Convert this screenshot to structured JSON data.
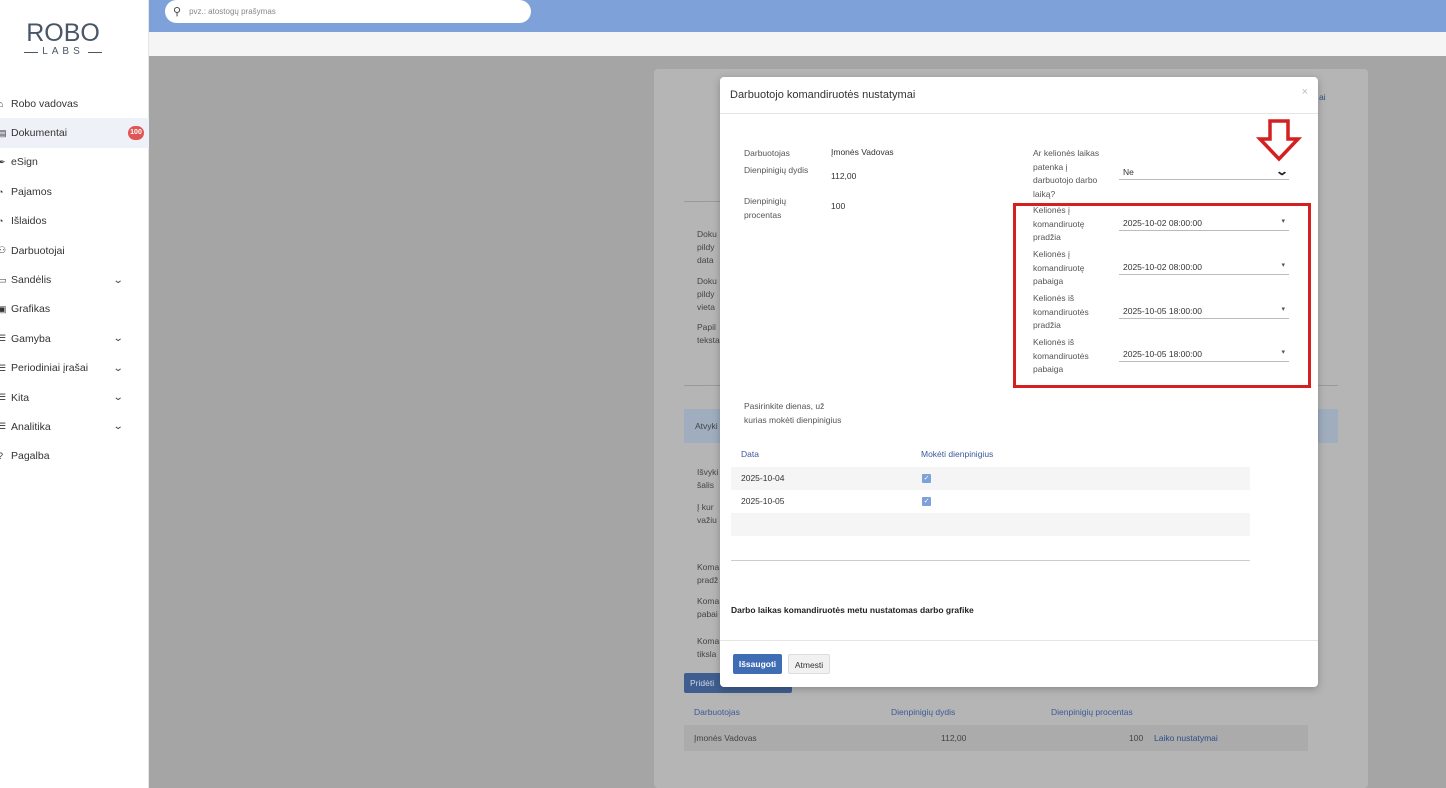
{
  "logo": {
    "main": "ROBO",
    "sub": "LABS"
  },
  "search": {
    "placeholder": "pvz.: atostogų prašymas"
  },
  "sidebar": {
    "items": [
      {
        "label": "Robo vadovas",
        "icon": "home-icon"
      },
      {
        "label": "Dokumentai",
        "icon": "document-icon",
        "badge": "100"
      },
      {
        "label": "eSign",
        "icon": "pen-icon"
      },
      {
        "label": "Pajamos",
        "icon": "income-icon"
      },
      {
        "label": "Išlaidos",
        "icon": "expense-icon"
      },
      {
        "label": "Darbuotojai",
        "icon": "people-icon"
      },
      {
        "label": "Sandėlis",
        "icon": "warehouse-icon"
      },
      {
        "label": "Grafikas",
        "icon": "calendar-icon"
      },
      {
        "label": "Gamyba",
        "icon": "list-icon"
      },
      {
        "label": "Periodiniai įrašai",
        "icon": "list-icon"
      },
      {
        "label": "Kita",
        "icon": "list-icon"
      },
      {
        "label": "Analitika",
        "icon": "list-icon"
      },
      {
        "label": "Pagalba",
        "icon": "help-icon"
      }
    ]
  },
  "background": {
    "left_fragments": [
      "Doku",
      "pildy",
      "data",
      "Doku",
      "pildy",
      "vieta",
      "Papil",
      "teksta",
      "Atvyki",
      "Išvyki",
      "šalis",
      "Į kur",
      "važiu",
      "Koma",
      "pradž",
      "Koma",
      "pabai",
      "Koma",
      "tiksla"
    ],
    "right_fragment": "ai",
    "add_button": "Pridėti",
    "table": {
      "headers": [
        "Darbuotojas",
        "Dienpinigių dydis",
        "Dienpinigių procentas"
      ],
      "row": {
        "employee": "Įmonės Vadovas",
        "size": "112,00",
        "percent": "100",
        "link": "Laiko nustatymai"
      }
    }
  },
  "modal": {
    "title": "Darbuotojo komandiruotės nustatymai",
    "close": "×",
    "employee_label": "Darbuotojas",
    "employee_value": "Įmonės Vadovas",
    "allowance_size_label": "Dienpinigių dydis",
    "allowance_size_value": "112,00",
    "allowance_percent_label": "Dienpinigių procentas",
    "allowance_percent_value": "100",
    "travel_time_question": "Ar kelionės laikas patenka į darbuotojo darbo laiką?",
    "travel_time_value": "Ne",
    "trip_fields": [
      {
        "label": "Kelionės į komandiruotę pradžia",
        "value": "2025-10-02 08:00:00"
      },
      {
        "label": "Kelionės į komandiruotę pabaiga",
        "value": "2025-10-02 08:00:00"
      },
      {
        "label": "Kelionės iš komandiruotės pradžia",
        "value": "2025-10-05 18:00:00"
      },
      {
        "label": "Kelionės iš komandiruotės pabaiga",
        "value": "2025-10-05 18:00:00"
      }
    ],
    "days_prompt": "Pasirinkite dienas, už kurias mokėti dienpinigius",
    "days_table": {
      "headers": [
        "Data",
        "Mokėti dienpinigius"
      ],
      "rows": [
        {
          "date": "2025-10-04",
          "checked": true
        },
        {
          "date": "2025-10-05",
          "checked": true
        }
      ]
    },
    "note": "Darbo laikas komandiruotės metu nustatomas darbo grafike",
    "save_label": "Išsaugoti",
    "cancel_label": "Atmesti"
  },
  "colors": {
    "topbar": "#7ea1d9",
    "primary": "#3f6db3",
    "highlight": "#d42020",
    "badge": "#e05555"
  }
}
